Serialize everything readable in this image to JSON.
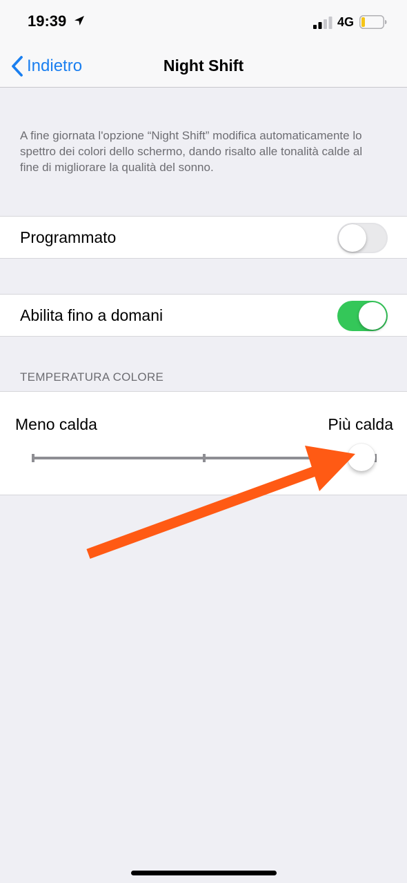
{
  "status_bar": {
    "time": "19:39",
    "network": "4G",
    "icons": [
      "location-arrow-icon",
      "signal-icon",
      "battery-icon"
    ],
    "battery_color": "#f5c518"
  },
  "nav": {
    "back_label": "Indietro",
    "title": "Night Shift",
    "accent_color": "#1a7ff0"
  },
  "description": "A fine giornata l'opzione “Night Shift” modifica automaticamente lo spettro dei colori dello schermo, dando risalto alle tonalità calde al fine di migliorare la qualità del sonno.",
  "settings": {
    "scheduled": {
      "label": "Programmato",
      "enabled": false
    },
    "enable_until_tomorrow": {
      "label": "Abilita fino a domani",
      "enabled": true,
      "on_color": "#34c759"
    }
  },
  "color_temperature": {
    "header": "TEMPERATURA COLORE",
    "min_label": "Meno calda",
    "max_label": "Più calda",
    "value": 0.96
  },
  "annotation": {
    "type": "arrow",
    "color": "#ff5a14"
  }
}
